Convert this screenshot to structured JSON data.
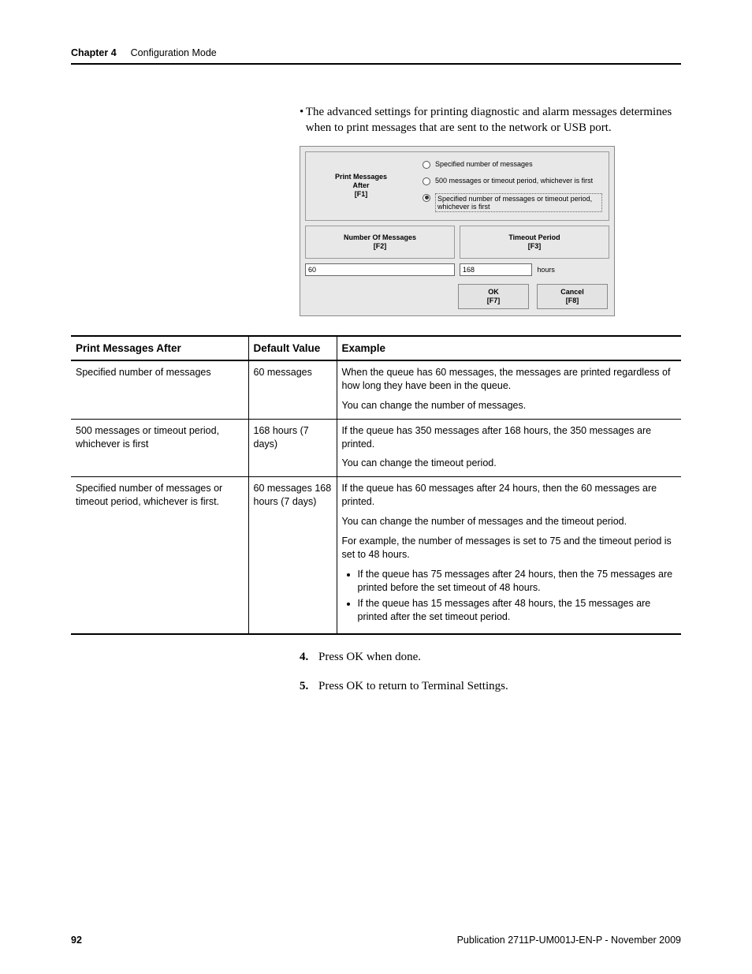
{
  "header": {
    "chapter": "Chapter 4",
    "title": "Configuration Mode"
  },
  "intro_bullet": "The advanced settings for printing diagnostic and alarm messages determines when to print messages that are sent to the network or USB port.",
  "dialog": {
    "print_after_label": "Print Messages\nAfter\n[F1]",
    "radio1": "Specified number of messages",
    "radio2": "500 messages or timeout period, whichever is first",
    "radio3": "Specified number of messages or timeout period, whichever is first",
    "num_msgs_label": "Number Of Messages\n[F2]",
    "timeout_label": "Timeout Period\n[F3]",
    "num_value": "60",
    "timeout_value": "168",
    "hours": "hours",
    "ok": "OK\n[F7]",
    "cancel": "Cancel\n[F8]"
  },
  "table": {
    "headers": [
      "Print Messages After",
      "Default Value",
      "Example"
    ],
    "rows": [
      {
        "c1": "Specified number of messages",
        "c2": "60 messages",
        "c3": [
          "When the queue has 60 messages, the messages are printed regardless of how long they have been in the queue.",
          "You can change the number of messages."
        ]
      },
      {
        "c1": "500 messages or timeout period, whichever is first",
        "c2": "168 hours (7 days)",
        "c3": [
          "If the queue has 350 messages after 168 hours, the 350 messages are printed.",
          "You can change the timeout period."
        ]
      },
      {
        "c1": "Specified number of messages or timeout period, whichever is first.",
        "c2": "60 messages 168 hours (7 days)",
        "c3": [
          "If the queue has 60 messages after 24 hours, then the 60 messages are printed.",
          "You can change the number of messages and the timeout period.",
          "For example, the number of messages is set to 75 and the timeout period is set to 48 hours."
        ],
        "bullets": [
          "If the queue has 75 messages after 24 hours, then the 75 messages are printed before the set timeout of 48 hours.",
          "If the queue has 15 messages after 48 hours, the 15 messages are printed after the set timeout period."
        ]
      }
    ]
  },
  "steps": {
    "s4": "Press OK when done.",
    "s5": "Press OK to return to Terminal Settings."
  },
  "footer": {
    "page": "92",
    "pub": "Publication 2711P-UM001J-EN-P - November 2009"
  }
}
